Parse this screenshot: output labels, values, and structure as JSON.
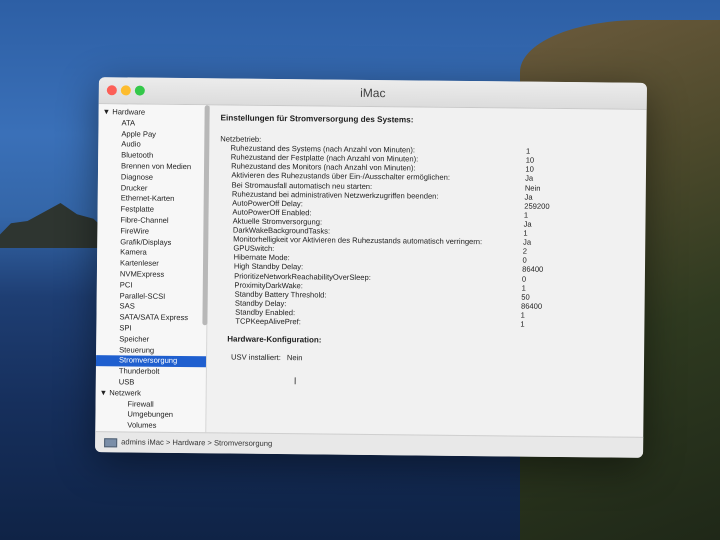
{
  "window": {
    "title": "iMac"
  },
  "sidebar": {
    "items": [
      {
        "label": "▼ Hardware",
        "level": "group"
      },
      {
        "label": "ATA",
        "level": "item"
      },
      {
        "label": "Apple Pay",
        "level": "item"
      },
      {
        "label": "Audio",
        "level": "item"
      },
      {
        "label": "Bluetooth",
        "level": "item"
      },
      {
        "label": "Brennen von Medien",
        "level": "item"
      },
      {
        "label": "Diagnose",
        "level": "item"
      },
      {
        "label": "Drucker",
        "level": "item"
      },
      {
        "label": "Ethernet-Karten",
        "level": "item"
      },
      {
        "label": "Festplatte",
        "level": "item"
      },
      {
        "label": "Fibre-Channel",
        "level": "item"
      },
      {
        "label": "FireWire",
        "level": "item"
      },
      {
        "label": "Grafik/Displays",
        "level": "item"
      },
      {
        "label": "Kamera",
        "level": "item"
      },
      {
        "label": "Kartenleser",
        "level": "item"
      },
      {
        "label": "NVMExpress",
        "level": "item"
      },
      {
        "label": "PCI",
        "level": "item"
      },
      {
        "label": "Parallel-SCSI",
        "level": "item"
      },
      {
        "label": "SAS",
        "level": "item"
      },
      {
        "label": "SATA/SATA Express",
        "level": "item"
      },
      {
        "label": "SPI",
        "level": "item"
      },
      {
        "label": "Speicher",
        "level": "item"
      },
      {
        "label": "Steuerung",
        "level": "item"
      },
      {
        "label": "Stromversorgung",
        "level": "item",
        "selected": true
      },
      {
        "label": "Thunderbolt",
        "level": "item"
      },
      {
        "label": "USB",
        "level": "item"
      },
      {
        "label": "▼ Netzwerk",
        "level": "group"
      },
      {
        "label": "Firewall",
        "level": "sub"
      },
      {
        "label": "Umgebungen",
        "level": "sub"
      },
      {
        "label": "Volumes",
        "level": "sub"
      }
    ]
  },
  "content": {
    "heading": "Einstellungen für Stromversorgung des Systems:",
    "rows": [
      {
        "key": "Netzbetrieb:",
        "value": "",
        "indent": 0
      },
      {
        "key": "Ruhezustand des Systems (nach Anzahl von Minuten):",
        "value": "1",
        "indent": 1
      },
      {
        "key": "Ruhezustand der Festplatte (nach Anzahl von Minuten):",
        "value": "10",
        "indent": 1
      },
      {
        "key": "Ruhezustand des Monitors (nach Anzahl von Minuten):",
        "value": "10",
        "indent": 1
      },
      {
        "key": "Aktivieren des Ruhezustands über Ein-/Ausschalter ermöglichen:",
        "value": "Ja",
        "indent": 1
      },
      {
        "key": "Bei Stromausfall automatisch neu starten:",
        "value": "Nein",
        "indent": 1
      },
      {
        "key": "Ruhezustand bei administrativen Netzwerkzugriffen beenden:",
        "value": "Ja",
        "indent": 1
      },
      {
        "key": "AutoPowerOff Delay:",
        "value": "259200",
        "indent": 1
      },
      {
        "key": "AutoPowerOff Enabled:",
        "value": "1",
        "indent": 1
      },
      {
        "key": "Aktuelle Stromversorgung:",
        "value": "Ja",
        "indent": 1
      },
      {
        "key": "DarkWakeBackgroundTasks:",
        "value": "1",
        "indent": 1
      },
      {
        "key": "Monitorhelligkeit vor Aktivieren des Ruhezustands automatisch verringern:",
        "value": "Ja",
        "indent": 1
      },
      {
        "key": "GPUSwitch:",
        "value": "2",
        "indent": 1
      },
      {
        "key": "Hibernate Mode:",
        "value": "0",
        "indent": 1
      },
      {
        "key": "High Standby Delay:",
        "value": "86400",
        "indent": 1
      },
      {
        "key": "PrioritizeNetworkReachabilityOverSleep:",
        "value": "0",
        "indent": 1
      },
      {
        "key": "ProximityDarkWake:",
        "value": "1",
        "indent": 1
      },
      {
        "key": "Standby Battery Threshold:",
        "value": "50",
        "indent": 1
      },
      {
        "key": "Standby Delay:",
        "value": "86400",
        "indent": 1
      },
      {
        "key": "Standby Enabled:",
        "value": "1",
        "indent": 1
      },
      {
        "key": "TCPKeepAlivePref:",
        "value": "1",
        "indent": 1
      }
    ],
    "hardware_heading": "Hardware-Konfiguration:",
    "usv_label": "USV installiert:",
    "usv_value": "Nein"
  },
  "statusbar": {
    "path": "admins iMac > Hardware > Stromversorgung"
  },
  "colors": {
    "selection": "#1f5fcf",
    "close": "#fc5f57",
    "minimize": "#fdbc2e",
    "maximize": "#34c84a"
  }
}
